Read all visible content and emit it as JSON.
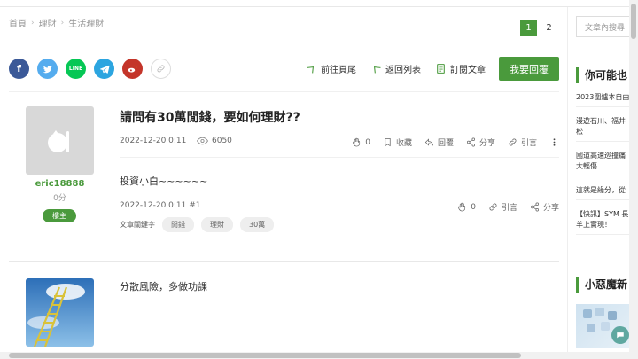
{
  "breadcrumb": [
    {
      "label": "首頁"
    },
    {
      "label": "理財"
    },
    {
      "label": "生活理財"
    }
  ],
  "pager": {
    "pages": [
      "1",
      "2"
    ],
    "active": "1"
  },
  "share": {
    "facebook": "f",
    "line": "LINE"
  },
  "actions": {
    "last_page": "前往頁尾",
    "back_list": "返回列表",
    "subscribe": "訂閱文章",
    "reply": "我要回覆"
  },
  "author": {
    "name": "eric18888",
    "score": "0分",
    "badge": "樓主"
  },
  "post": {
    "title": "請問有30萬閒錢，要如何理財??",
    "date": "2022-12-20 0:11",
    "views": "6050",
    "likes": "0",
    "favorite": "收藏",
    "reply": "回覆",
    "share": "分享",
    "quote": "引言",
    "body": "投資小白~~~~~~",
    "foot_date": "2022-12-20 0:11 #1",
    "foot_likes": "0",
    "foot_quote": "引言",
    "foot_share": "分享",
    "keywords_label": "文章關鍵字",
    "keywords": [
      "閒錢",
      "理財",
      "30萬"
    ]
  },
  "post2": {
    "title": "分散風險，多做功課"
  },
  "sidebar": {
    "search_placeholder": "文章內搜尋",
    "section1": "你可能也",
    "items": [
      {
        "l1": "2023圍爐本自由"
      },
      {
        "l1": "漫遊石川、福井",
        "l2": "松"
      },
      {
        "l1": "國道高速巡撞痛",
        "l2": "大輕傷"
      },
      {
        "l1": "這就是緣分，從"
      },
      {
        "l1": "【快訊】SYM 長",
        "l2": "羊上實現！"
      }
    ],
    "section2": "小惡魔新"
  },
  "colors": {
    "accent": "#4a9a3c",
    "facebook": "#3b5998",
    "twitter": "#55acee",
    "line": "#06c755",
    "telegram": "#2ca5e0",
    "weibo": "#c4352a"
  }
}
